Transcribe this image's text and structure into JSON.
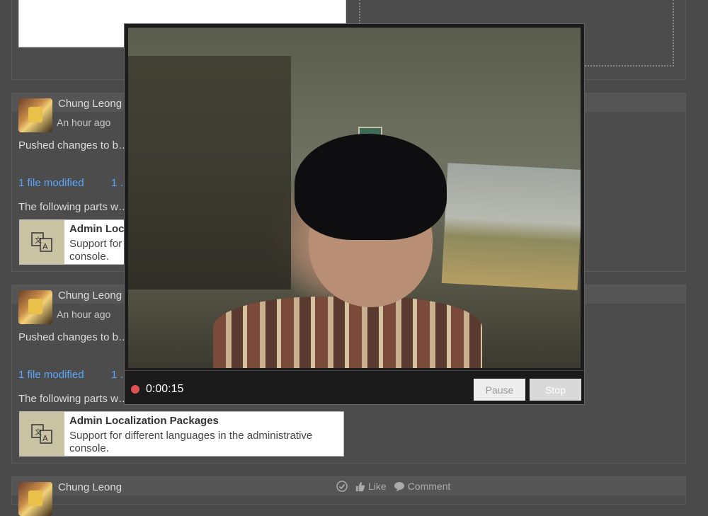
{
  "stories": [
    {
      "user": "Chung Leong",
      "time": "An hour ago",
      "summary": "Pushed changes to b… “trambar”",
      "files_modified": "1 file modified",
      "files_other": "1 …",
      "parts_text": "The following parts w…",
      "component": {
        "name": "Admin Localization Packages",
        "description": "Support for different languages in the administrative console."
      }
    },
    {
      "user": "Chung Leong",
      "time": "An hour ago",
      "summary": "Pushed changes to b… “trambar”",
      "files_modified": "1 file modified",
      "files_other": "1 …",
      "parts_text": "The following parts w…",
      "component": {
        "name": "Admin Localization Packages",
        "description": "Support for different languages in the administrative console."
      }
    },
    {
      "user": "Chung Leong",
      "like_label": "Like",
      "comment_label": "Comment"
    }
  ],
  "recorder": {
    "timer": "0:00:15",
    "pause_label": "Pause",
    "stop_label": "Stop",
    "status_color": "#e05050"
  }
}
